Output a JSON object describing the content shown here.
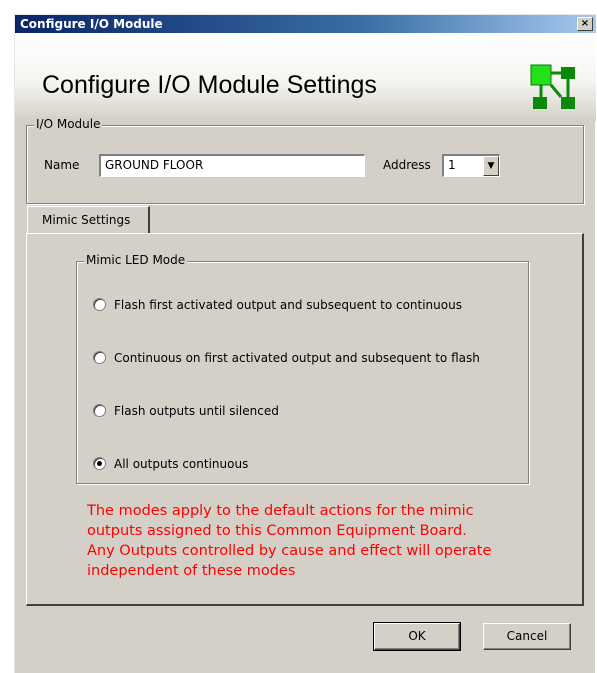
{
  "window": {
    "title": "Configure I/O Module",
    "close_glyph": "×"
  },
  "header": {
    "heading": "Configure I/O Module Settings",
    "logo_icon": "green-network-icon"
  },
  "io_module": {
    "group_label": "I/O Module",
    "name_label": "Name",
    "name_value": "GROUND FLOOR",
    "address_label": "Address",
    "address_value": "1"
  },
  "tabs": [
    {
      "label": "Mimic Settings",
      "active": true
    }
  ],
  "mimic": {
    "group_label": "Mimic LED Mode",
    "options": [
      {
        "label": "Flash first activated output and subsequent to continuous",
        "selected": false
      },
      {
        "label": "Continuous on first activated output and subsequent to flash",
        "selected": false
      },
      {
        "label": "Flash outputs until silenced",
        "selected": false
      },
      {
        "label": "All outputs continuous",
        "selected": true
      }
    ],
    "note_lines": [
      "The modes apply to the default actions for the mimic",
      "outputs assigned to this Common Equipment Board.",
      "Any Outputs controlled by cause and effect will operate",
      "independent of these modes"
    ],
    "note_color": "#ff0000"
  },
  "buttons": {
    "ok": "OK",
    "cancel": "Cancel"
  }
}
